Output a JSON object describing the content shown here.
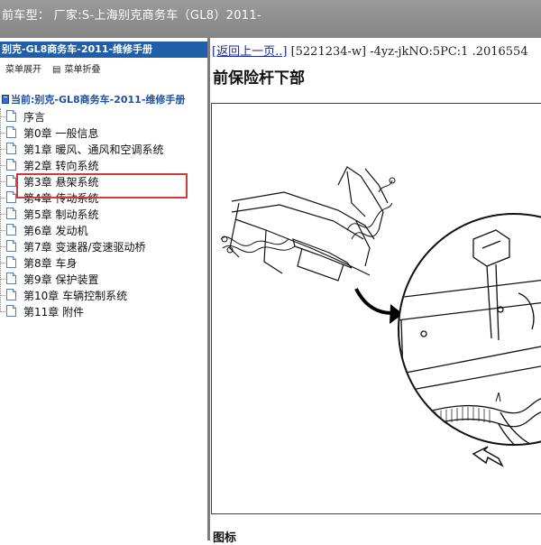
{
  "topbar": {
    "title": "前车型： 厂家:S-上海别克商务车（GL8）2011-"
  },
  "sidebar": {
    "header": "别克-GL8商务车-2011-维修手册",
    "tools": {
      "expand": "菜单展开",
      "collapse_icon": "▤",
      "collapse": "菜单折叠"
    },
    "current": "当前:别克-GL8商务车-2011-维修手册",
    "items": [
      {
        "label": "序言"
      },
      {
        "label": "第0章 一般信息"
      },
      {
        "label": "第1章 暖风、通风和空调系统"
      },
      {
        "label": "第2章 转向系统"
      },
      {
        "label": "第3章 悬架系统"
      },
      {
        "label": "第4章 传动系统"
      },
      {
        "label": "第5章 制动系统"
      },
      {
        "label": "第6章 发动机"
      },
      {
        "label": "第7章 变速器/变速驱动桥"
      },
      {
        "label": "第8章 车身"
      },
      {
        "label": "第9章 保护装置"
      },
      {
        "label": "第10章 车辆控制系统"
      },
      {
        "label": "第11章 附件"
      }
    ]
  },
  "content": {
    "back_link": "[返回上一页..]",
    "breadcrumb_info": "[5221234-w] -4yz-jkNO:5PC:1 .2016554",
    "page_title": "前保险杆下部",
    "caption": "图标"
  }
}
